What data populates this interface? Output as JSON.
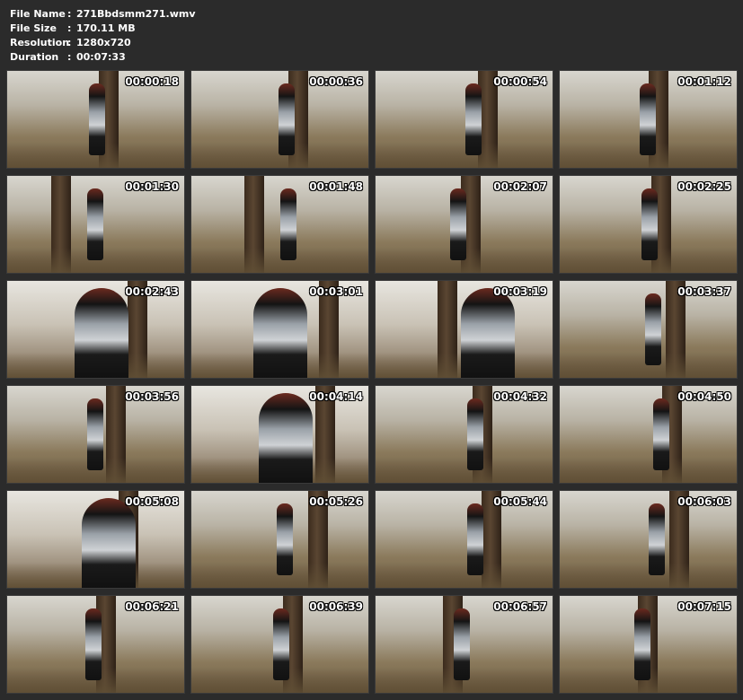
{
  "info": {
    "file_name": {
      "label": "File Name",
      "value": "271Bbdsmm271.wmv"
    },
    "file_size": {
      "label": "File Size",
      "value": "170.11 MB"
    },
    "resolution": {
      "label": "Resolution",
      "value": "1280x720"
    },
    "duration": {
      "label": "Duration",
      "value": "00:07:33"
    },
    "separator": ":"
  },
  "thumbnails": [
    {
      "time": "00:00:18"
    },
    {
      "time": "00:00:36"
    },
    {
      "time": "00:00:54"
    },
    {
      "time": "00:01:12"
    },
    {
      "time": "00:01:30"
    },
    {
      "time": "00:01:48"
    },
    {
      "time": "00:02:07"
    },
    {
      "time": "00:02:25"
    },
    {
      "time": "00:02:43"
    },
    {
      "time": "00:03:01"
    },
    {
      "time": "00:03:19"
    },
    {
      "time": "00:03:37"
    },
    {
      "time": "00:03:56"
    },
    {
      "time": "00:04:14"
    },
    {
      "time": "00:04:32"
    },
    {
      "time": "00:04:50"
    },
    {
      "time": "00:05:08"
    },
    {
      "time": "00:05:26"
    },
    {
      "time": "00:05:44"
    },
    {
      "time": "00:06:03"
    },
    {
      "time": "00:06:21"
    },
    {
      "time": "00:06:39"
    },
    {
      "time": "00:06:57"
    },
    {
      "time": "00:07:15"
    }
  ]
}
